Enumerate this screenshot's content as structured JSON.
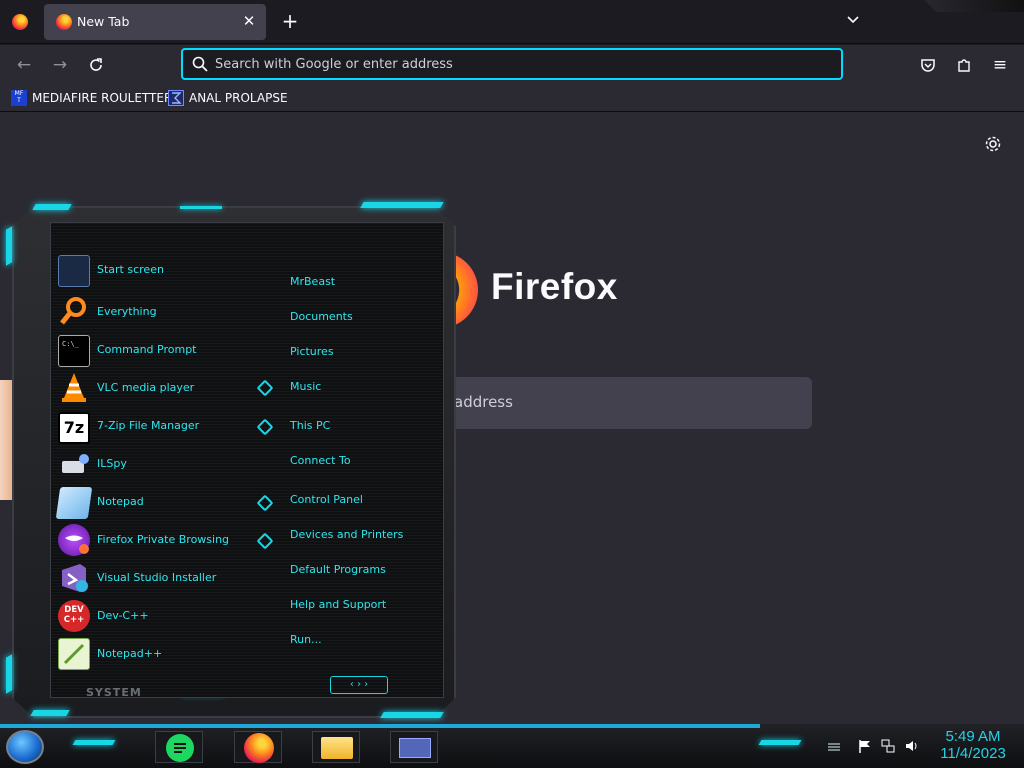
{
  "browser": {
    "tab": {
      "title": "New Tab"
    },
    "new_tab_icon": "plus-icon",
    "urlbar": {
      "placeholder": "Search with Google or enter address"
    },
    "bookmarks": [
      {
        "label": "MEDIAFIRE ROULETTER",
        "icon_text": "MF\nT"
      },
      {
        "label": "ANAL PROLAPSE",
        "icon": "sigma-icon"
      }
    ]
  },
  "newtab": {
    "brand": "Firefox",
    "search_placeholder_visible": "address"
  },
  "start_menu": {
    "apps": [
      {
        "label": "Start screen",
        "icon": "start-screen-icon"
      },
      {
        "label": "Everything",
        "icon": "magnifier-icon"
      },
      {
        "label": "Command Prompt",
        "icon": "cmd-icon"
      },
      {
        "label": "VLC media player",
        "icon": "vlc-cone-icon"
      },
      {
        "label": "7-Zip File Manager",
        "icon": "7zip-icon",
        "icon_text": "7z"
      },
      {
        "label": "ILSpy",
        "icon": "ilspy-icon"
      },
      {
        "label": "Notepad",
        "icon": "notepad-icon"
      },
      {
        "label": "Firefox Private Browsing",
        "icon": "firefox-private-icon"
      },
      {
        "label": "Visual Studio Installer",
        "icon": "vs-installer-icon"
      },
      {
        "label": "Dev-C++",
        "icon": "devcpp-icon",
        "icon_text": "DEV\nC++"
      },
      {
        "label": "Notepad++",
        "icon": "notepadpp-icon"
      }
    ],
    "places": [
      {
        "label": "MrBeast",
        "arrow": false
      },
      {
        "label": "Documents",
        "arrow": false
      },
      {
        "label": "Pictures",
        "arrow": false
      },
      {
        "label": "Music",
        "arrow": true
      },
      {
        "label": "This PC",
        "arrow": true
      },
      {
        "label": "Connect To",
        "arrow": false
      },
      {
        "label": "Control Panel",
        "arrow": true
      },
      {
        "label": "Devices and Printers",
        "arrow": true
      },
      {
        "label": "Default Programs",
        "arrow": false
      },
      {
        "label": "Help and Support",
        "arrow": false
      },
      {
        "label": "Run...",
        "arrow": false
      }
    ],
    "footer_label": "SYSTEM"
  },
  "taskbar": {
    "pinned": [
      {
        "name": "spotify-like-app",
        "icon": "notes-app-icon"
      },
      {
        "name": "firefox",
        "icon": "firefox-icon"
      },
      {
        "name": "file-explorer",
        "icon": "folder-icon"
      },
      {
        "name": "window-app",
        "icon": "window-icon"
      }
    ],
    "clock": {
      "time": "5:49 AM",
      "date": "11/4/2023"
    }
  },
  "colors": {
    "accent_cyan": "#2fe6ee",
    "focus_ring": "#00ddff",
    "toolbar": "#2b2a33"
  }
}
